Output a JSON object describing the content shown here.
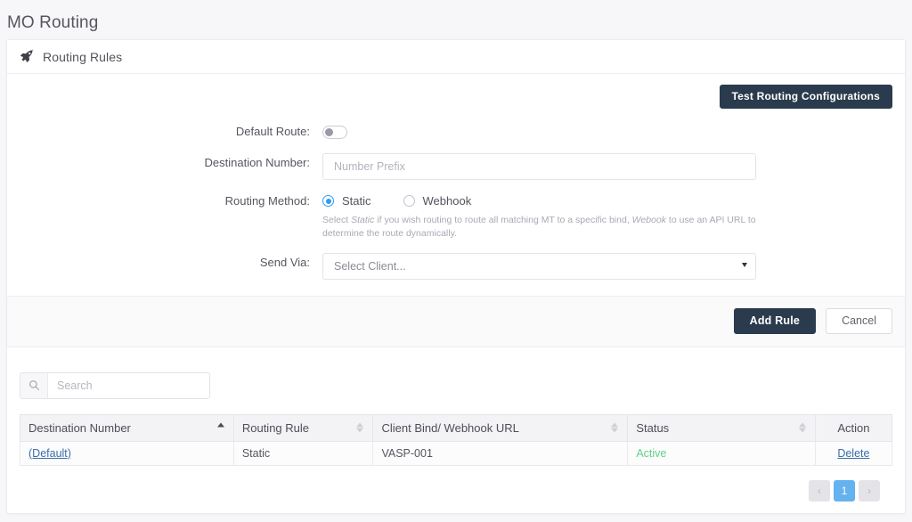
{
  "page": {
    "title": "MO Routing"
  },
  "card": {
    "header_title": "Routing Rules",
    "header_icon": "rocket-icon",
    "test_button": "Test Routing Configurations"
  },
  "form": {
    "default_route": {
      "label": "Default Route:",
      "state": "off"
    },
    "destination_number": {
      "label": "Destination Number:",
      "value": "",
      "placeholder": "Number Prefix"
    },
    "routing_method": {
      "label": "Routing Method:",
      "options": [
        {
          "label": "Static",
          "selected": true
        },
        {
          "label": "Webhook",
          "selected": false
        }
      ],
      "help_prefix": "Select ",
      "help_em1": "Static",
      "help_mid": " if you wish routing to route all matching MT to a specific bind, ",
      "help_em2": "Webook",
      "help_suffix": " to use an API URL to determine the route dynamically."
    },
    "send_via": {
      "label": "Send Via:",
      "value": "Select Client...",
      "caret_icon": "chevron-down-icon"
    },
    "add_rule_button": "Add Rule",
    "cancel_button": "Cancel"
  },
  "list": {
    "search": {
      "placeholder": "Search",
      "value": "",
      "icon": "search-icon"
    },
    "columns": [
      {
        "label": "Destination Number",
        "sort": "asc"
      },
      {
        "label": "Routing Rule",
        "sort": "none"
      },
      {
        "label": "Client Bind/ Webhook URL",
        "sort": "none"
      },
      {
        "label": "Status",
        "sort": "none"
      },
      {
        "label": "Action",
        "sort": null
      }
    ],
    "rows": [
      {
        "destination_number": "(Default)",
        "routing_rule": "Static",
        "client_bind": "VASP-001",
        "status": "Active",
        "action": "Delete"
      }
    ],
    "pagination": {
      "prev": "‹",
      "pages": [
        "1"
      ],
      "next": "›",
      "current": "1"
    }
  },
  "colors": {
    "accent_dark": "#2a3b4d",
    "radio_blue": "#2d9cf0",
    "link_blue": "#3a6ea5",
    "status_active": "#5fd18a",
    "page_active": "#64b2ee"
  }
}
